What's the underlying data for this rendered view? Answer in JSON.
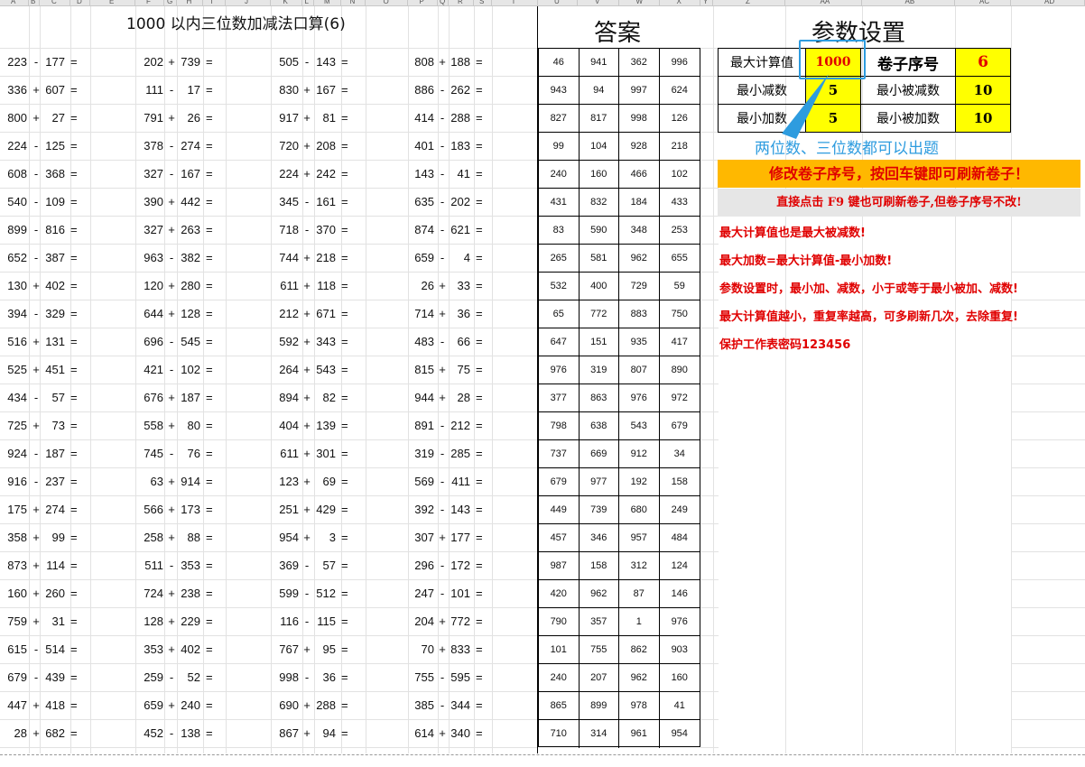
{
  "sheet": {
    "title": "1000 以内三位数加减法口算(6)",
    "answer_title": "答案",
    "params_title": "参数设置",
    "columns": [
      "A",
      "B",
      "C",
      "D",
      "E",
      "F",
      "G",
      "H",
      "I",
      "J",
      "K",
      "L",
      "M",
      "N",
      "O",
      "P",
      "Q",
      "R",
      "S",
      "T",
      "U",
      "V",
      "W",
      "X",
      "Y",
      "Z",
      "AA",
      "AB",
      "AC",
      "AD"
    ]
  },
  "problems": {
    "eq": "=",
    "blocks": [
      [
        [
          "223",
          "-",
          "177"
        ],
        [
          "336",
          "+",
          "607"
        ],
        [
          "800",
          "+",
          "27"
        ],
        [
          "224",
          "-",
          "125"
        ],
        [
          "608",
          "-",
          "368"
        ],
        [
          "540",
          "-",
          "109"
        ],
        [
          "899",
          "-",
          "816"
        ],
        [
          "652",
          "-",
          "387"
        ],
        [
          "130",
          "+",
          "402"
        ],
        [
          "394",
          "-",
          "329"
        ],
        [
          "516",
          "+",
          "131"
        ],
        [
          "525",
          "+",
          "451"
        ],
        [
          "434",
          "-",
          "57"
        ],
        [
          "725",
          "+",
          "73"
        ],
        [
          "924",
          "-",
          "187"
        ],
        [
          "916",
          "-",
          "237"
        ],
        [
          "175",
          "+",
          "274"
        ],
        [
          "358",
          "+",
          "99"
        ],
        [
          "873",
          "+",
          "114"
        ],
        [
          "160",
          "+",
          "260"
        ],
        [
          "759",
          "+",
          "31"
        ],
        [
          "615",
          "-",
          "514"
        ],
        [
          "679",
          "-",
          "439"
        ],
        [
          "447",
          "+",
          "418"
        ],
        [
          "28",
          "+",
          "682"
        ]
      ],
      [
        [
          "202",
          "+",
          "739"
        ],
        [
          "111",
          "-",
          "17"
        ],
        [
          "791",
          "+",
          "26"
        ],
        [
          "378",
          "-",
          "274"
        ],
        [
          "327",
          "-",
          "167"
        ],
        [
          "390",
          "+",
          "442"
        ],
        [
          "327",
          "+",
          "263"
        ],
        [
          "963",
          "-",
          "382"
        ],
        [
          "120",
          "+",
          "280"
        ],
        [
          "644",
          "+",
          "128"
        ],
        [
          "696",
          "-",
          "545"
        ],
        [
          "421",
          "-",
          "102"
        ],
        [
          "676",
          "+",
          "187"
        ],
        [
          "558",
          "+",
          "80"
        ],
        [
          "745",
          "-",
          "76"
        ],
        [
          "63",
          "+",
          "914"
        ],
        [
          "566",
          "+",
          "173"
        ],
        [
          "258",
          "+",
          "88"
        ],
        [
          "511",
          "-",
          "353"
        ],
        [
          "724",
          "+",
          "238"
        ],
        [
          "128",
          "+",
          "229"
        ],
        [
          "353",
          "+",
          "402"
        ],
        [
          "259",
          "-",
          "52"
        ],
        [
          "659",
          "+",
          "240"
        ],
        [
          "452",
          "-",
          "138"
        ]
      ],
      [
        [
          "505",
          "-",
          "143"
        ],
        [
          "830",
          "+",
          "167"
        ],
        [
          "917",
          "+",
          "81"
        ],
        [
          "720",
          "+",
          "208"
        ],
        [
          "224",
          "+",
          "242"
        ],
        [
          "345",
          "-",
          "161"
        ],
        [
          "718",
          "-",
          "370"
        ],
        [
          "744",
          "+",
          "218"
        ],
        [
          "611",
          "+",
          "118"
        ],
        [
          "212",
          "+",
          "671"
        ],
        [
          "592",
          "+",
          "343"
        ],
        [
          "264",
          "+",
          "543"
        ],
        [
          "894",
          "+",
          "82"
        ],
        [
          "404",
          "+",
          "139"
        ],
        [
          "611",
          "+",
          "301"
        ],
        [
          "123",
          "+",
          "69"
        ],
        [
          "251",
          "+",
          "429"
        ],
        [
          "954",
          "+",
          "3"
        ],
        [
          "369",
          "-",
          "57"
        ],
        [
          "599",
          "-",
          "512"
        ],
        [
          "116",
          "-",
          "115"
        ],
        [
          "767",
          "+",
          "95"
        ],
        [
          "998",
          "-",
          "36"
        ],
        [
          "690",
          "+",
          "288"
        ],
        [
          "867",
          "+",
          "94"
        ]
      ],
      [
        [
          "808",
          "+",
          "188"
        ],
        [
          "886",
          "-",
          "262"
        ],
        [
          "414",
          "-",
          "288"
        ],
        [
          "401",
          "-",
          "183"
        ],
        [
          "143",
          "-",
          "41"
        ],
        [
          "635",
          "-",
          "202"
        ],
        [
          "874",
          "-",
          "621"
        ],
        [
          "659",
          "-",
          "4"
        ],
        [
          "26",
          "+",
          "33"
        ],
        [
          "714",
          "+",
          "36"
        ],
        [
          "483",
          "-",
          "66"
        ],
        [
          "815",
          "+",
          "75"
        ],
        [
          "944",
          "+",
          "28"
        ],
        [
          "891",
          "-",
          "212"
        ],
        [
          "319",
          "-",
          "285"
        ],
        [
          "569",
          "-",
          "411"
        ],
        [
          "392",
          "-",
          "143"
        ],
        [
          "307",
          "+",
          "177"
        ],
        [
          "296",
          "-",
          "172"
        ],
        [
          "247",
          "-",
          "101"
        ],
        [
          "204",
          "+",
          "772"
        ],
        [
          "70",
          "+",
          "833"
        ],
        [
          "755",
          "-",
          "595"
        ],
        [
          "385",
          "-",
          "344"
        ],
        [
          "614",
          "+",
          "340"
        ]
      ]
    ]
  },
  "answers": [
    [
      "46",
      "941",
      "362",
      "996"
    ],
    [
      "943",
      "94",
      "997",
      "624"
    ],
    [
      "827",
      "817",
      "998",
      "126"
    ],
    [
      "99",
      "104",
      "928",
      "218"
    ],
    [
      "240",
      "160",
      "466",
      "102"
    ],
    [
      "431",
      "832",
      "184",
      "433"
    ],
    [
      "83",
      "590",
      "348",
      "253"
    ],
    [
      "265",
      "581",
      "962",
      "655"
    ],
    [
      "532",
      "400",
      "729",
      "59"
    ],
    [
      "65",
      "772",
      "883",
      "750"
    ],
    [
      "647",
      "151",
      "935",
      "417"
    ],
    [
      "976",
      "319",
      "807",
      "890"
    ],
    [
      "377",
      "863",
      "976",
      "972"
    ],
    [
      "798",
      "638",
      "543",
      "679"
    ],
    [
      "737",
      "669",
      "912",
      "34"
    ],
    [
      "679",
      "977",
      "192",
      "158"
    ],
    [
      "449",
      "739",
      "680",
      "249"
    ],
    [
      "457",
      "346",
      "957",
      "484"
    ],
    [
      "987",
      "158",
      "312",
      "124"
    ],
    [
      "420",
      "962",
      "87",
      "146"
    ],
    [
      "790",
      "357",
      "1",
      "976"
    ],
    [
      "101",
      "755",
      "862",
      "903"
    ],
    [
      "240",
      "207",
      "962",
      "160"
    ],
    [
      "865",
      "899",
      "978",
      "41"
    ],
    [
      "710",
      "314",
      "961",
      "954"
    ]
  ],
  "params": {
    "max_calc_label": "最大计算值",
    "max_calc_value": "1000",
    "paper_no_label": "卷子序号",
    "paper_no_value": "6",
    "min_sub_label": "最小减数",
    "min_sub_value": "5",
    "min_minuend_label": "最小被减数",
    "min_minuend_value": "10",
    "min_add_label": "最小加数",
    "min_add_value": "5",
    "min_augend_label": "最小被加数",
    "min_augend_value": "10",
    "callout": "两位数、三位数都可以出题"
  },
  "notes": {
    "refresh_banner": "修改卷子序号，按回车键即可刷新卷子！",
    "f9_banner": "直接点击 F9 键也可刷新卷子,但卷子序号不改!",
    "lines": [
      "最大计算值也是最大被减数!",
      "最大加数=最大计算值-最小加数!",
      "参数设置时，最小加、减数，小于或等于最小被加、减数!",
      "最大计算值越小，重复率越高，可多刷新几次，去除重复!",
      "保护工作表密码123456"
    ]
  },
  "colors": {
    "yellow": "#ffff00",
    "orange": "#ffb800",
    "red": "#e00000",
    "callout_blue": "#2e9cdf",
    "grid": "#e2e2e2"
  }
}
